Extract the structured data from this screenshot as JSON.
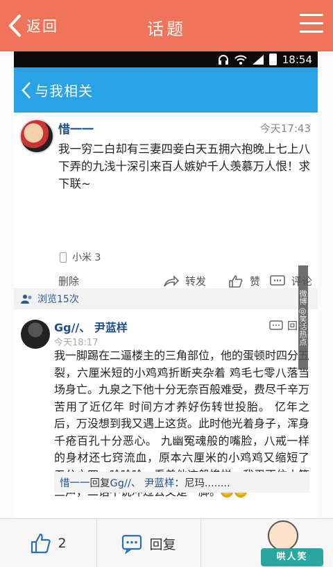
{
  "app_bar": {
    "back_label": "返回",
    "title": "话题",
    "bg_color": "#f0745a"
  },
  "status_bar": {
    "time": "18:54",
    "icons": [
      "headphone-icon",
      "wifi-icon",
      "signal-icon",
      "battery-icon"
    ]
  },
  "nav": {
    "back_label": "与我相关",
    "bg_color": "#2aa2e6"
  },
  "post": {
    "author": "惜一一",
    "time": "今天17:43",
    "body": "我一穷二白却有三妻四妾白天五拥六抱晚上七上八下弄的九浅十深引来百人嫉妒千人羡慕万人恨！求下联~",
    "device": "小米 3",
    "delete_label": "删除",
    "share_label": "转发",
    "like_label": "赞",
    "comment_label": "评论"
  },
  "views": {
    "label": "浏览15次"
  },
  "reply": {
    "author": "Gg//、 尹蓝样",
    "reply_label": "回复",
    "time": "今天18:17",
    "body": "我一脚踢在二逼楼主的三角部位，他的蛋顿时四分五裂，六厘米短的小鸡鸡折断夹杂着 鸡毛七零八落当场身亡。九泉之下他十分无奈百般难受，费尽千辛万苦用了近亿年 时间方才养好伤转世投胎。 亿年之后，万没想到我又遇上这货。此时他光着身子，浑身千疮百孔十分恶心。 九幽冤魂般的嘴脸，八戒一样的身材还七窍流血，原本六厘米的小鸡鸡又缩短了 五分之四。哈哈哈，看着他这般惨样，我忍不住大笑三声，二话不说冲过去又是一脚。",
    "sub_reply": {
      "from": "惜一一",
      "verb": "回复",
      "to": "Gg//、 尹蓝样",
      "text": "：尼玛........"
    }
  },
  "watermark": "微博 @笑话热点",
  "bottom_bar": {
    "like_count": "2",
    "reply_label": "回复",
    "mascot_text": "哄人笑"
  }
}
